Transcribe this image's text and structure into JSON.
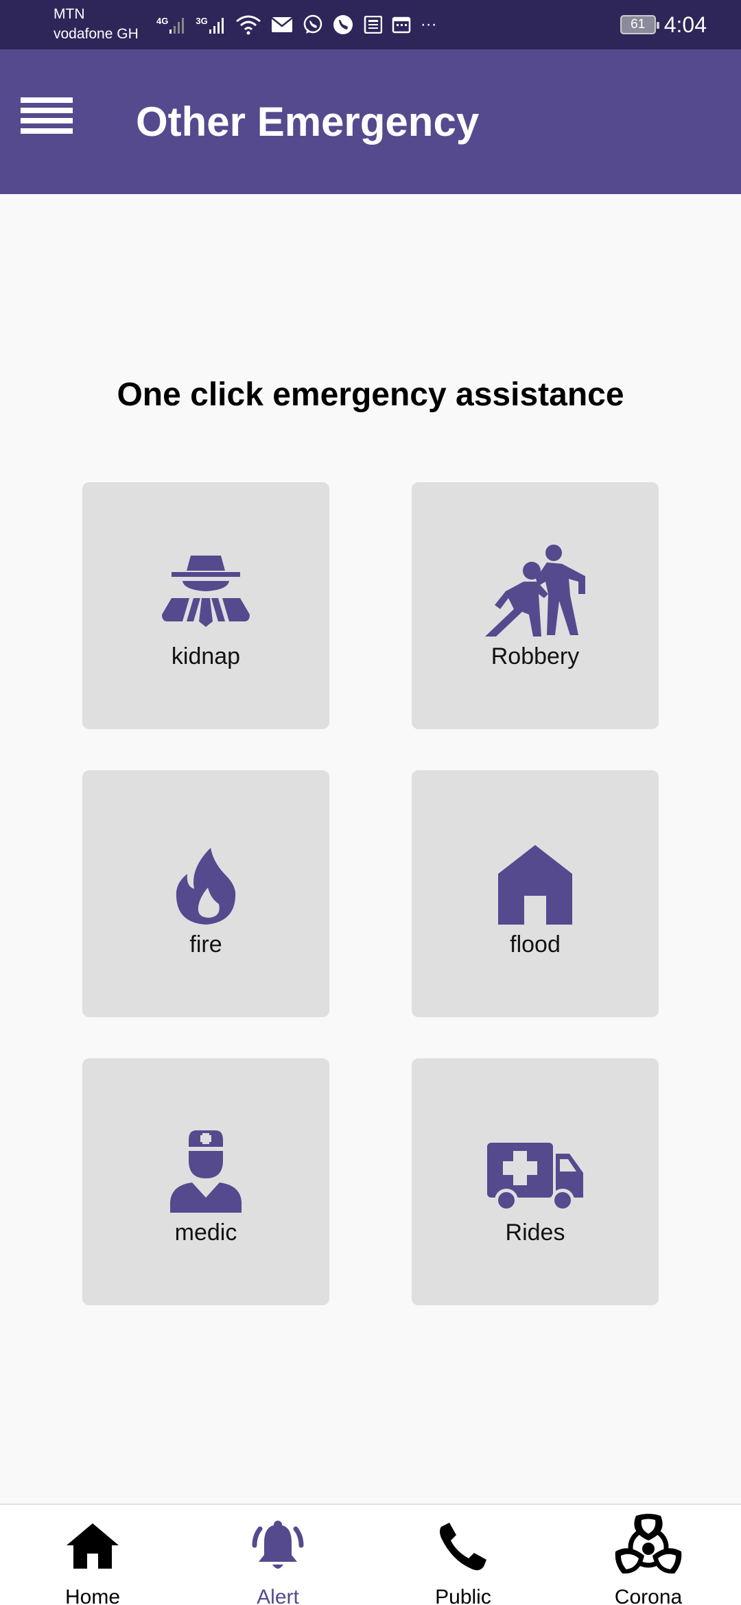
{
  "status_bar": {
    "carrier_1": "MTN",
    "carrier_2": "vodafone GH",
    "network_1": "4G",
    "network_2": "3G",
    "overflow": "···",
    "battery": "61",
    "time": "4:04"
  },
  "app_bar": {
    "title": "Other Emergency"
  },
  "tagline": "One click emergency assistance",
  "tiles": [
    {
      "label": "kidnap",
      "icon": "kidnap-icon"
    },
    {
      "label": "Robbery",
      "icon": "robbery-icon"
    },
    {
      "label": "fire",
      "icon": "fire-icon"
    },
    {
      "label": "flood",
      "icon": "house-icon"
    },
    {
      "label": "medic",
      "icon": "doctor-icon"
    },
    {
      "label": "Rides",
      "icon": "ambulance-icon"
    }
  ],
  "bottom_nav": [
    {
      "label": "Home",
      "icon": "home-icon"
    },
    {
      "label": "Alert",
      "icon": "bell-icon",
      "active": true
    },
    {
      "label": "Public",
      "icon": "phone-icon"
    },
    {
      "label": "Corona",
      "icon": "biohazard-icon"
    }
  ],
  "colors": {
    "primary": "#554a8e",
    "status_bar": "#2e2659",
    "tile_bg": "#dfdfdf",
    "page_bg": "#f9f9f9"
  }
}
